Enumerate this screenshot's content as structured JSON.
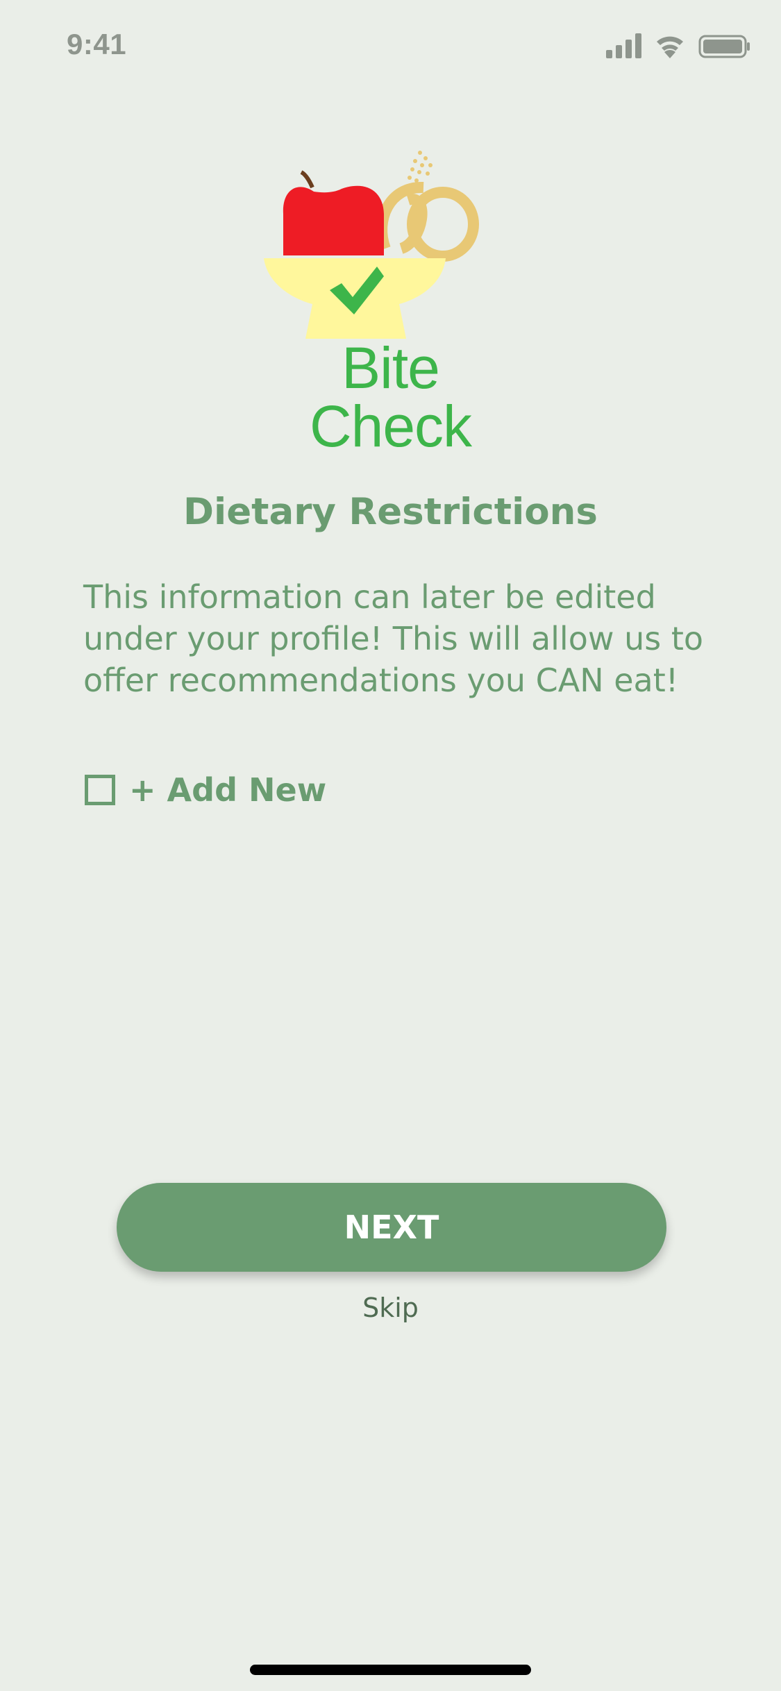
{
  "status_bar": {
    "time": "9:41",
    "icons": [
      "cellular-signal-icon",
      "wifi-icon",
      "battery-icon"
    ]
  },
  "logo": {
    "text": "Bite Check",
    "icon": "food-bowl-check-logo"
  },
  "page": {
    "title": "Dietary Restrictions",
    "description": "This information can later be edited under your profile! This will allow us to offer recommendations you CAN eat!"
  },
  "restrictions": {
    "add_new_label": "+ Add New",
    "add_new_checked": false
  },
  "actions": {
    "next_label": "NEXT",
    "skip_label": "Skip"
  },
  "colors": {
    "background": "#EAEEE8",
    "primary": "#6A9C71",
    "logo_green": "#3DB54A",
    "bowl_yellow": "#FFF79C",
    "apple_red": "#EE1C25",
    "pretzel_gold": "#E8C875"
  }
}
